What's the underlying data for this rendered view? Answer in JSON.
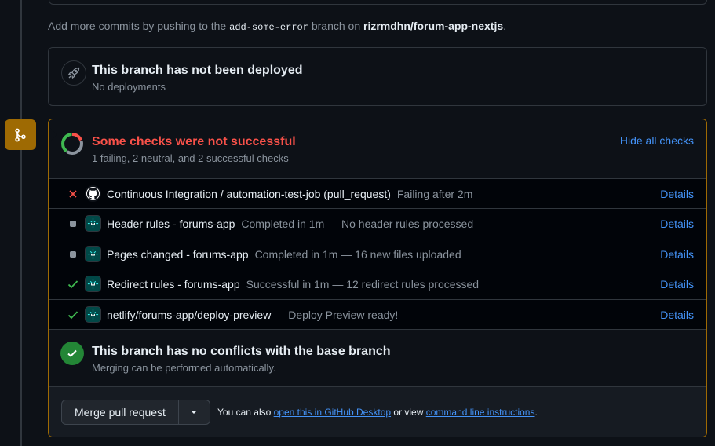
{
  "push_hint": {
    "prefix": "Add more commits by pushing to the",
    "branch": "add-some-error",
    "middle": "branch on",
    "repo": "rizrmdhn/forum-app-nextjs",
    "suffix": "."
  },
  "deployment": {
    "title": "This branch has not been deployed",
    "subtitle": "No deployments"
  },
  "checks": {
    "title": "Some checks were not successful",
    "subtitle": "1 failing, 2 neutral, and 2 successful checks",
    "hide_label": "Hide all checks",
    "summary": {
      "failing": 1,
      "neutral": 2,
      "successful": 2
    },
    "items": [
      {
        "status": "failing",
        "app": "github-icon",
        "name": "Continuous Integration / automation-test-job (pull_request)",
        "description": "Failing after 2m",
        "details": "Details"
      },
      {
        "status": "neutral",
        "app": "netlify-icon",
        "name": "Header rules - forums-app",
        "description": "Completed in 1m — No header rules processed",
        "details": "Details"
      },
      {
        "status": "neutral",
        "app": "netlify-icon",
        "name": "Pages changed - forums-app",
        "description": "Completed in 1m — 16 new files uploaded",
        "details": "Details"
      },
      {
        "status": "success",
        "app": "netlify-icon",
        "name": "Redirect rules - forums-app",
        "description": "Successful in 1m — 12 redirect rules processed",
        "details": "Details"
      },
      {
        "status": "success",
        "app": "netlify-icon",
        "name": "netlify/forums-app/deploy-preview",
        "description": "— Deploy Preview ready!",
        "details": "Details"
      }
    ]
  },
  "conflicts": {
    "title": "This branch has no conflicts with the base branch",
    "subtitle": "Merging can be performed automatically."
  },
  "merge": {
    "button": "Merge pull request",
    "also_prefix": "You can also",
    "desktop_link": "open this in GitHub Desktop",
    "or_view": "or view",
    "cli_link": "command line instructions",
    "suffix": "."
  },
  "colors": {
    "background": "#0d1117",
    "border": "#30363d",
    "warning": "#9e6a03",
    "danger": "#f85149",
    "success": "#3fb950",
    "neutral": "#8b949e",
    "link": "#4493f8"
  }
}
